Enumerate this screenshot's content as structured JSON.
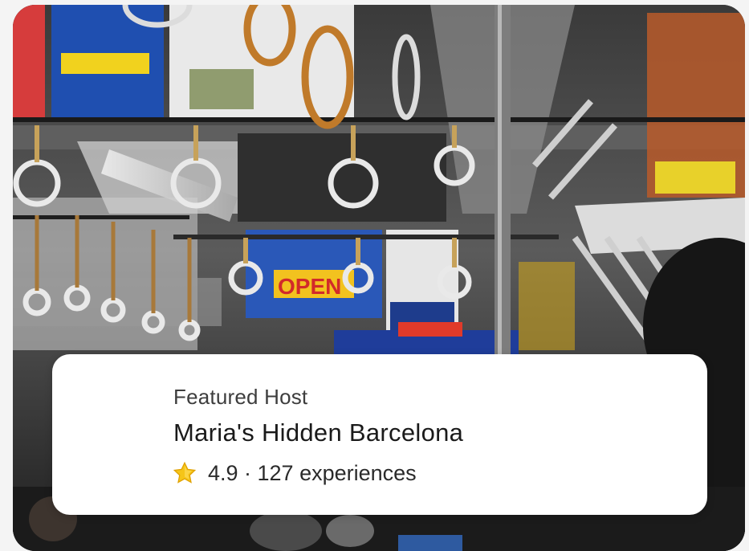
{
  "card": {
    "eyebrow": "Featured Host",
    "title": "Maria's Hidden Barcelona",
    "rating_line": "4.9 · 127 experiences",
    "icon": "star-icon",
    "rating": 4.9,
    "experiences_count": 127
  },
  "photo": {
    "subject": "train-interior-photo",
    "sign_text": "OPEN"
  },
  "colors": {
    "card_bg": "#ffffff",
    "star": "#f5c518",
    "title_text": "#1a1a1a"
  }
}
